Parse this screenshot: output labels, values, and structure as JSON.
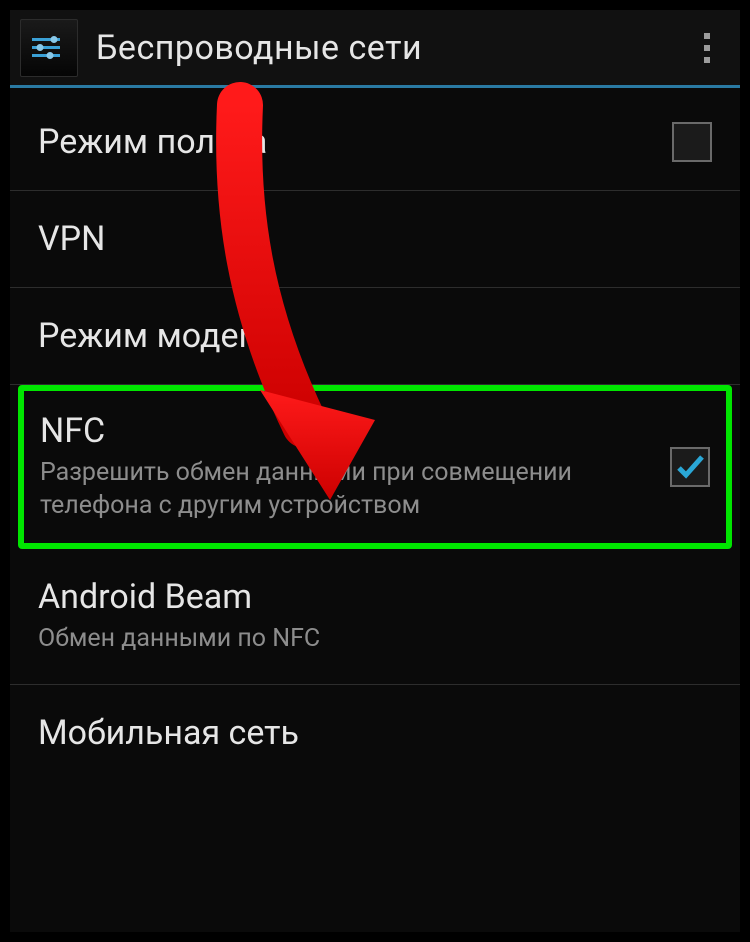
{
  "header": {
    "title": "Беспроводные сети",
    "back_icon_name": "settings-icon",
    "menu_icon_name": "overflow-menu-icon"
  },
  "rows": {
    "airplane": {
      "label": "Режим полета",
      "checked": false
    },
    "vpn": {
      "label": "VPN"
    },
    "tether": {
      "label": "Режим модема"
    },
    "nfc": {
      "label": "NFC",
      "sub": "Разрешить обмен данными при совмещении телефона с другим устройством",
      "checked": true
    },
    "beam": {
      "label": "Android Beam",
      "sub": "Обмен данными по NFC"
    },
    "mobile": {
      "label": "Мобильная сеть"
    }
  },
  "annotation": {
    "type": "arrow",
    "color": "#ff0000"
  }
}
